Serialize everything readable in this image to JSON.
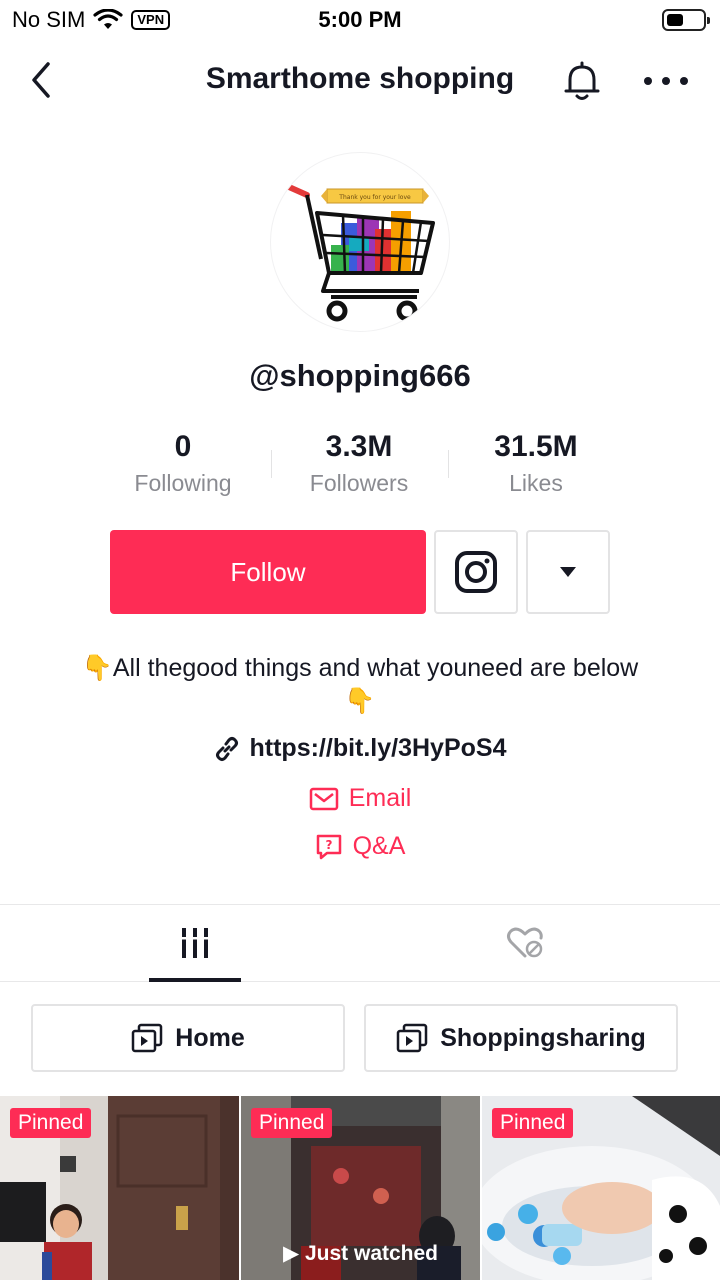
{
  "status_bar": {
    "carrier": "No SIM",
    "vpn": "VPN",
    "time": "5:00 PM",
    "battery_level": 0.45
  },
  "nav": {
    "title": "Smarthome shopping",
    "back_icon": "chevron-left-icon",
    "bell_icon": "bell-icon",
    "more_icon": "more-dots-icon"
  },
  "profile": {
    "avatar_banner": "Thank you for your love",
    "username": "@shopping666"
  },
  "stats": [
    {
      "value": "0",
      "label": "Following"
    },
    {
      "value": "3.3M",
      "label": "Followers"
    },
    {
      "value": "31.5M",
      "label": "Likes"
    }
  ],
  "actions": {
    "follow_label": "Follow",
    "instagram_icon": "instagram-icon",
    "dropdown_icon": "triangle-down-icon"
  },
  "bio": {
    "text": "👇All thegood things and what youneed are below 👇",
    "link": "https://bit.ly/3HyPoS4",
    "email_label": "Email",
    "qa_label": "Q&A"
  },
  "tabs": [
    {
      "icon": "videos-grid-icon",
      "active": true
    },
    {
      "icon": "liked-hidden-icon",
      "active": false
    }
  ],
  "playlists": [
    {
      "label": "Home",
      "icon": "playlist-icon"
    },
    {
      "label": "Shoppingsharing",
      "icon": "playlist-icon"
    }
  ],
  "videos": [
    {
      "badge": "Pinned",
      "overlay": ""
    },
    {
      "badge": "Pinned",
      "overlay": "▶ Just watched"
    },
    {
      "badge": "Pinned",
      "overlay": ""
    }
  ],
  "colors": {
    "accent": "#fe2c55",
    "text": "#161823",
    "muted": "#8a8b91"
  }
}
